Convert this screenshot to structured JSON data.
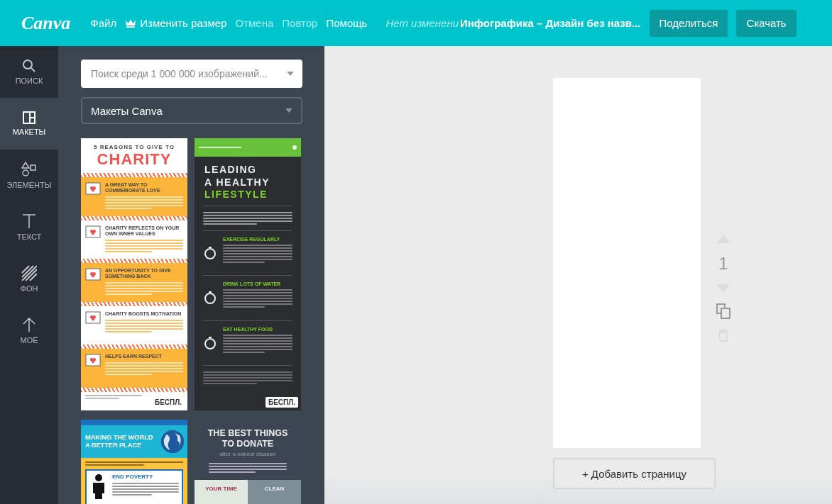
{
  "topbar": {
    "logo": "Canva",
    "menu": [
      {
        "label": "Файл",
        "disabled": false
      },
      {
        "label": "Изменить размер",
        "disabled": false
      },
      {
        "label": "Отмена",
        "disabled": true
      },
      {
        "label": "Повтор",
        "disabled": true
      },
      {
        "label": "Помощь",
        "disabled": false
      }
    ],
    "save_status": "Нет изменени",
    "title": "Инфографика – Дизайн без назв...",
    "buttons": [
      "Поделиться",
      "Скачать"
    ]
  },
  "rail": [
    {
      "label": "ПОИСК",
      "selected": false
    },
    {
      "label": "МАКЕТЫ",
      "selected": true
    },
    {
      "label": "ЭЛЕМЕНТЫ",
      "selected": false
    },
    {
      "label": "ТЕКСТ",
      "selected": false
    },
    {
      "label": "ФОН",
      "selected": false
    },
    {
      "label": "МОЁ",
      "selected": false
    }
  ],
  "panel": {
    "search": {
      "placeholder": "Поиск среди 1 000 000 изображений..."
    },
    "filter": {
      "value": "Макеты Canva"
    },
    "templates": [
      {
        "kind": "charity",
        "title": [
          "5 REASONS TO GIVE TO",
          "CHARITY"
        ],
        "sections": [
          "A GREAT WAY TO COMMEMORATE LOVE",
          "CHARITY REFLECTS ON YOUR OWN INNER VALUES",
          "AN OPPORTUNITY TO GIVE SOMETHING BACK",
          "CHARITY BOOSTS MOTIVATION",
          "HELPS EARN RESPECT"
        ],
        "badge": "БЕСПЛ."
      },
      {
        "kind": "lifestyle",
        "title": [
          "LEADING",
          "A HEALTHY",
          "LIFESTYLE"
        ],
        "sections": [
          "EXERCISE REGULARLY",
          "DRINK LOTS OF WATER",
          "EAT HEALTHY FOOD"
        ],
        "badge": "БЕСПЛ."
      },
      {
        "kind": "world",
        "title": [
          "MAKING THE WORLD",
          "A BETTER PLACE"
        ],
        "sections": [
          "END POVERTY"
        ]
      },
      {
        "kind": "donate",
        "title": [
          "THE BEST THINGS",
          "TO DONATE"
        ],
        "subtitle": "after a natural disaster",
        "sections": [
          "YOUR TIME",
          "CLEAN"
        ]
      }
    ]
  },
  "editor": {
    "page_number": "1",
    "up_disabled": true,
    "down_disabled": true,
    "delete_disabled": true,
    "add_page": "+ Добавить страницу"
  }
}
